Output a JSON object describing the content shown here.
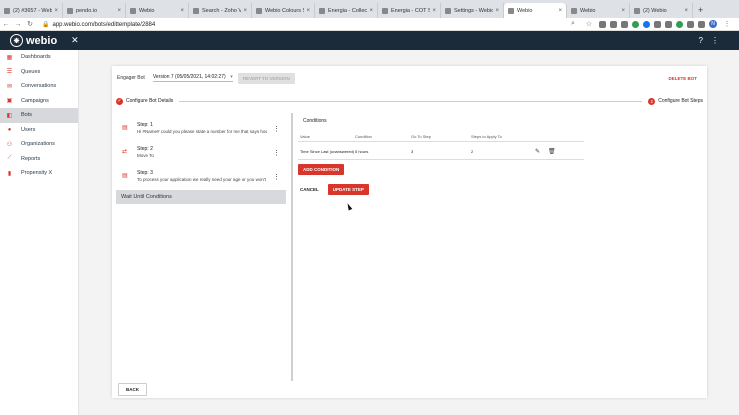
{
  "browser": {
    "tabs": [
      {
        "title": "(2) #3657 - Webio",
        "active": false
      },
      {
        "title": "pendo.io",
        "active": false
      },
      {
        "title": "Webio",
        "active": false
      },
      {
        "title": "Search - Zoho Vault",
        "active": false
      },
      {
        "title": "Webio Colours Style",
        "active": false
      },
      {
        "title": "Energia - Collections",
        "active": false
      },
      {
        "title": "Energia - COT Sales",
        "active": false
      },
      {
        "title": "Settings - Webio",
        "active": false
      },
      {
        "title": "Webio",
        "active": true
      },
      {
        "title": "Webio",
        "active": false
      },
      {
        "title": "(2) Webio",
        "active": false
      }
    ],
    "url": "app.webio.com/bots/edittemplate/2884",
    "new_tab": "+",
    "profile_initial": "N"
  },
  "app": {
    "logo": "webio",
    "brand_color": "#d9362b",
    "header_bg": "#1c2b39"
  },
  "sidebar": {
    "items": [
      {
        "label": "Dashboards",
        "icon": "dashboard-icon",
        "glyph": "▦"
      },
      {
        "label": "Queues",
        "icon": "queues-icon",
        "glyph": "☰"
      },
      {
        "label": "Conversations",
        "icon": "conversations-icon",
        "glyph": "✉"
      },
      {
        "label": "Campaigns",
        "icon": "campaigns-icon",
        "glyph": "▣"
      },
      {
        "label": "Bots",
        "icon": "bots-icon",
        "glyph": "◧",
        "active": true
      },
      {
        "label": "Users",
        "icon": "users-icon",
        "glyph": "●"
      },
      {
        "label": "Organizations",
        "icon": "organizations-icon",
        "glyph": "⚇"
      },
      {
        "label": "Reports",
        "icon": "reports-icon",
        "glyph": "⟋"
      },
      {
        "label": "Propensity X",
        "icon": "propensity-icon",
        "glyph": "▮"
      }
    ]
  },
  "editor": {
    "bot_label": "Engager Bot",
    "version": "Version 7 (05/05/2021, 14:02:27)",
    "revert_label": "REVERT TO VERSION",
    "delete_label": "DELETE BOT",
    "stepper": {
      "step1": "Configure Bot Details",
      "step2_num": "2",
      "step2": "Configure Bot Steps"
    },
    "steps": [
      {
        "title": "Step: 1",
        "desc": "Hi #Name# could you please state a number for me that says how...",
        "icon": "message-icon"
      },
      {
        "title": "Step: 2",
        "desc": "Move To",
        "icon": "move-icon"
      },
      {
        "title": "Step: 3",
        "desc": "To process your application we really need your age or you won't b...",
        "icon": "message-icon"
      }
    ],
    "wait_label": "Wait Until Conditions",
    "conditions": {
      "title": "Conditions",
      "headers": [
        "Value",
        "Condition",
        "Go To Step",
        "Steps to Apply To"
      ],
      "rows": [
        {
          "value": "Time Since Last (unanswered)",
          "condition": "5 hours",
          "goto": "3",
          "apply": "2"
        }
      ],
      "add_label": "ADD CONDITION",
      "cancel_label": "CANCEL",
      "update_label": "UPDATE STEP"
    },
    "back_label": "BACK"
  }
}
